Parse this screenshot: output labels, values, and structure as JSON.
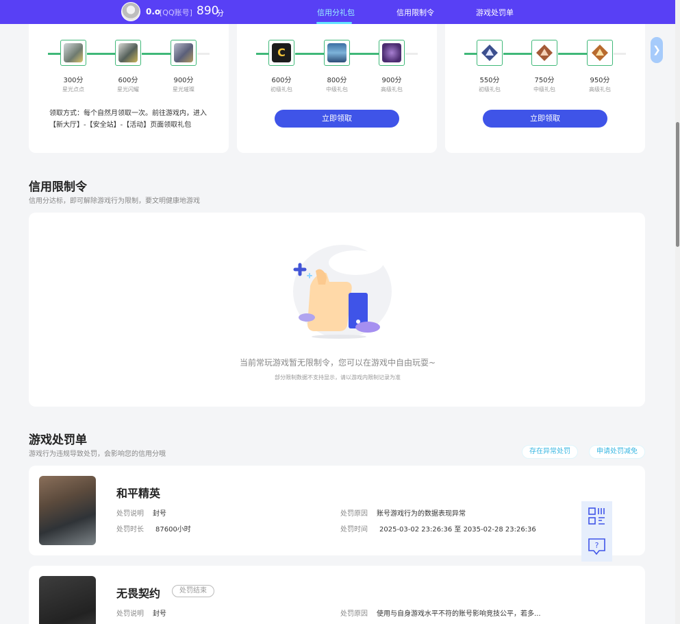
{
  "nav": {
    "username": "0.o",
    "account_type": "[QQ账号]",
    "score": "890",
    "score_unit": "分",
    "tabs": [
      {
        "label": "信用分礼包",
        "active": true
      },
      {
        "label": "信用限制令",
        "active": false
      },
      {
        "label": "游戏处罚单",
        "active": false
      }
    ]
  },
  "gift_cards": [
    {
      "tiers": [
        {
          "points": "300分",
          "label": "星光点点"
        },
        {
          "points": "600分",
          "label": "星光闪耀"
        },
        {
          "points": "900分",
          "label": "星光璀璨"
        }
      ],
      "description": "领取方式：每个自然月领取一次。前往游戏内，进入【新大厅】-【安全站】-【活动】页面领取礼包"
    },
    {
      "tiers": [
        {
          "points": "600分",
          "label": "初级礼包"
        },
        {
          "points": "800分",
          "label": "中级礼包"
        },
        {
          "points": "900分",
          "label": "高级礼包"
        }
      ],
      "button": "立即领取"
    },
    {
      "tiers": [
        {
          "points": "550分",
          "label": "初级礼包"
        },
        {
          "points": "750分",
          "label": "中级礼包"
        },
        {
          "points": "950分",
          "label": "高级礼包"
        }
      ],
      "button": "立即领取"
    }
  ],
  "limit_section": {
    "title": "信用限制令",
    "subtitle": "信用分达标，即可解除游戏行为限制，要文明健康地游戏",
    "empty_message": "当前常玩游戏暂无限制令，您可以在游戏中自由玩耍~",
    "empty_note": "部分限制数据不支持显示，请以游戏内限制记录为准"
  },
  "penalty_section": {
    "title": "游戏处罚单",
    "subtitle": "游戏行为违规导致处罚，会影响您的信用分哦",
    "actions": [
      "存在异常处罚",
      "申请处罚减免"
    ],
    "records": [
      {
        "game": "和平精英",
        "status": "",
        "desc_label": "处罚说明",
        "desc": "封号",
        "duration_label": "处罚时长",
        "duration": "87600小时",
        "reason_label": "处罚原因",
        "reason": "账号游戏行为的数据表现异常",
        "time_label": "处罚时间",
        "time": "2025-03-02 23:26:36 至 2035-02-28 23:26:36"
      },
      {
        "game": "无畏契约",
        "status": "处罚结束",
        "desc_label": "处罚说明",
        "desc": "封号",
        "reason_label": "处罚原因",
        "reason": "使用与自身游戏水平不符的账号影响竞技公平，若多..."
      }
    ]
  },
  "float_tools": [
    "qr-code-icon",
    "help-chat-icon"
  ]
}
